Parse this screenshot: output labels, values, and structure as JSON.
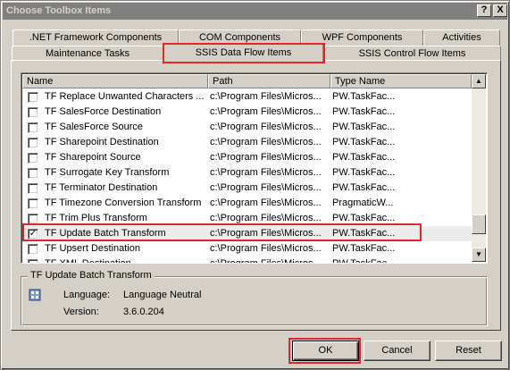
{
  "window": {
    "title": "Choose Toolbox Items",
    "help_label": "?",
    "close_label": "X"
  },
  "tabs": {
    "row1": [
      ".NET Framework Components",
      "COM Components",
      "WPF Components",
      "Activities"
    ],
    "row2": [
      "Maintenance Tasks",
      "SSIS Data Flow Items",
      "SSIS Control Flow Items"
    ],
    "active": "SSIS Data Flow Items"
  },
  "list": {
    "columns": [
      "Name",
      "Path",
      "Type Name"
    ],
    "rows": [
      {
        "name": "TF Replace Unwanted Characters ...",
        "path": "c:\\Program Files\\Micros...",
        "type": "PW.TaskFac...",
        "checked": false
      },
      {
        "name": "TF SalesForce Destination",
        "path": "c:\\Program Files\\Micros...",
        "type": "PW.TaskFac...",
        "checked": false
      },
      {
        "name": "TF SalesForce Source",
        "path": "c:\\Program Files\\Micros...",
        "type": "PW.TaskFac...",
        "checked": false
      },
      {
        "name": "TF Sharepoint Destination",
        "path": "c:\\Program Files\\Micros...",
        "type": "PW.TaskFac...",
        "checked": false
      },
      {
        "name": "TF Sharepoint Source",
        "path": "c:\\Program Files\\Micros...",
        "type": "PW.TaskFac...",
        "checked": false
      },
      {
        "name": "TF Surrogate Key Transform",
        "path": "c:\\Program Files\\Micros...",
        "type": "PW.TaskFac...",
        "checked": false
      },
      {
        "name": "TF Terminator Destination",
        "path": "c:\\Program Files\\Micros...",
        "type": "PW.TaskFac...",
        "checked": false
      },
      {
        "name": "TF Timezone Conversion Transform",
        "path": "c:\\Program Files\\Micros...",
        "type": "PragmaticW...",
        "checked": false
      },
      {
        "name": "TF Trim Plus Transform",
        "path": "c:\\Program Files\\Micros...",
        "type": "PW.TaskFac...",
        "checked": false
      },
      {
        "name": "TF Update Batch Transform",
        "path": "c:\\Program Files\\Micros...",
        "type": "PW.TaskFac...",
        "checked": true,
        "selected": true
      },
      {
        "name": "TF Upsert Destination",
        "path": "c:\\Program Files\\Micros...",
        "type": "PW.TaskFac...",
        "checked": false
      },
      {
        "name": "TF XML Destination",
        "path": "c:\\Program Files\\Micros...",
        "type": "PW.TaskFac...",
        "checked": false
      }
    ],
    "check_mark": "✓"
  },
  "details": {
    "title": "TF Update Batch Transform",
    "language_label": "Language:",
    "language_value": "Language Neutral",
    "version_label": "Version:",
    "version_value": "3.6.0.204"
  },
  "buttons": {
    "ok": "OK",
    "cancel": "Cancel",
    "reset": "Reset"
  },
  "colors": {
    "highlight_outline": "#e3262a",
    "window_face": "#d4d0c8",
    "titlebar_inactive": "#808080"
  }
}
